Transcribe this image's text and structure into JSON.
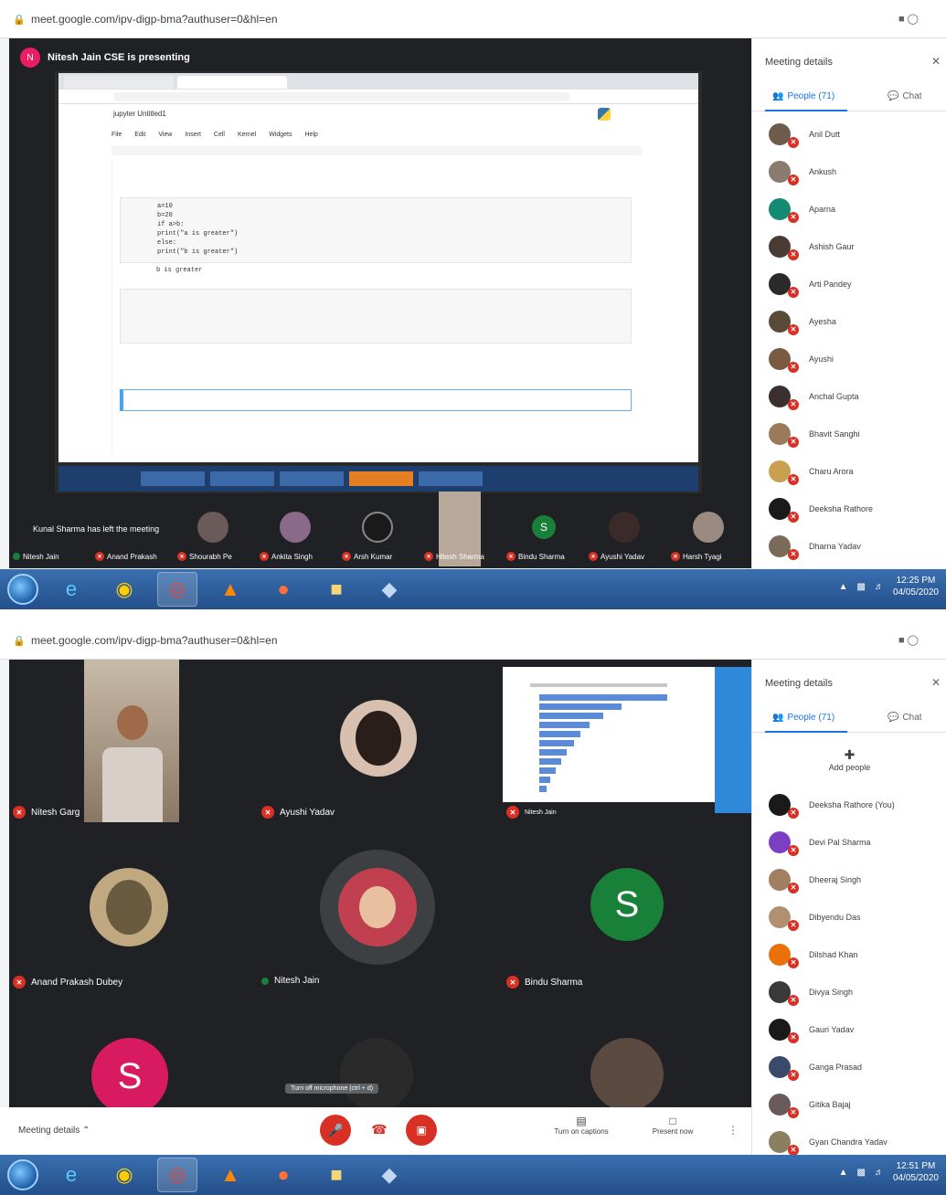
{
  "top": {
    "url": "meet.google.com/ipv-digp-bma?authuser=0&hl=en",
    "presenting_banner": "Nitesh Jain CSE is presenting",
    "notification": "Kunal Sharma has left the meeting",
    "panel": {
      "title": "Meeting details",
      "tab_people": "People (71)",
      "tab_chat": "Chat",
      "participants": [
        {
          "name": "Anil Dutt",
          "color": "#6d5b4b"
        },
        {
          "name": "Ankush",
          "color": "#8a7a70"
        },
        {
          "name": "Aparna",
          "color": "#138a72"
        },
        {
          "name": "Ashish Gaur",
          "color": "#4a3c34"
        },
        {
          "name": "Arti Pandey",
          "color": "#2a2a2a"
        },
        {
          "name": "Ayesha",
          "color": "#5a4a3a"
        },
        {
          "name": "Ayushi",
          "color": "#7a5a40"
        },
        {
          "name": "Anchal Gupta",
          "color": "#3a3030"
        },
        {
          "name": "Bhavit Sanghi",
          "color": "#9a7a5a"
        },
        {
          "name": "Charu Arora",
          "color": "#c9a050"
        },
        {
          "name": "Deeksha Rathore",
          "color": "#1a1a1a"
        },
        {
          "name": "Dharna Yadav",
          "color": "#7a6a5a"
        }
      ]
    },
    "strip": [
      {
        "name": "Nitesh Jain"
      },
      {
        "name": "Anand Prakash"
      },
      {
        "name": "Shourabh Pe"
      },
      {
        "name": "Ankita Singh"
      },
      {
        "name": "Arsh Kumar"
      },
      {
        "name": "Hitesh Sharma"
      },
      {
        "name": "Bindu Sharma"
      },
      {
        "name": "Ayushi Yadav"
      },
      {
        "name": "Harsh Tyagi"
      }
    ],
    "editor": {
      "menu": [
        "File",
        "Edit",
        "View",
        "Insert",
        "Cell",
        "Kernel",
        "Widgets",
        "Help"
      ],
      "title": "jupyter  Untitled1",
      "code_lines": [
        "a=10",
        "b=20",
        "if a>b:",
        "    print(\"a is greater\")",
        "else:",
        "    print(\"b is greater\")",
        "b is greater"
      ]
    },
    "clock_time": "12:25 PM",
    "clock_date": "04/05/2020"
  },
  "bottom": {
    "url": "meet.google.com/ipv-digp-bma?authuser=0&hl=en",
    "panel": {
      "title": "Meeting details",
      "tab_people": "People (71)",
      "tab_chat": "Chat",
      "add_people": "Add people",
      "participants": [
        {
          "name": "Deeksha Rathore (You)",
          "color": "#1a1a1a"
        },
        {
          "name": "Devi Pal Sharma",
          "color": "#7b3fc4"
        },
        {
          "name": "Dheeraj Singh",
          "color": "#a08060"
        },
        {
          "name": "Dibyendu Das",
          "color": "#b09070"
        },
        {
          "name": "Dilshad Khan",
          "color": "#e8710a"
        },
        {
          "name": "Divya Singh",
          "color": "#3a3a3a"
        },
        {
          "name": "Gauri Yadav",
          "color": "#1a1a1a"
        },
        {
          "name": "Ganga Prasad",
          "color": "#3a4a6a"
        },
        {
          "name": "Gitika Bajaj",
          "color": "#6a5a5a"
        },
        {
          "name": "Gyan Chandra Yadav",
          "color": "#8a8060"
        }
      ]
    },
    "tiles": [
      {
        "name": "Nitesh Garg"
      },
      {
        "name": "Ayushi Yadav"
      },
      {
        "name": "Nitesh Jain"
      },
      {
        "name": "Anand Prakash Dubey"
      },
      {
        "name": "Nitesh Jain"
      },
      {
        "name": "Bindu Sharma"
      }
    ],
    "avatars": {
      "bindu_letter": "S",
      "pink_letter": "S"
    },
    "controls": {
      "meeting_details": "Meeting details",
      "turn_on_captions": "Turn on captions",
      "present_now": "Present now",
      "tooltip": "Turn off microphone (ctrl + d)"
    },
    "clock_time": "12:51 PM",
    "clock_date": "04/05/2020"
  },
  "colors": {
    "meet_red": "#d93025",
    "stage_bg": "#202124",
    "accent": "#1a73e8"
  }
}
